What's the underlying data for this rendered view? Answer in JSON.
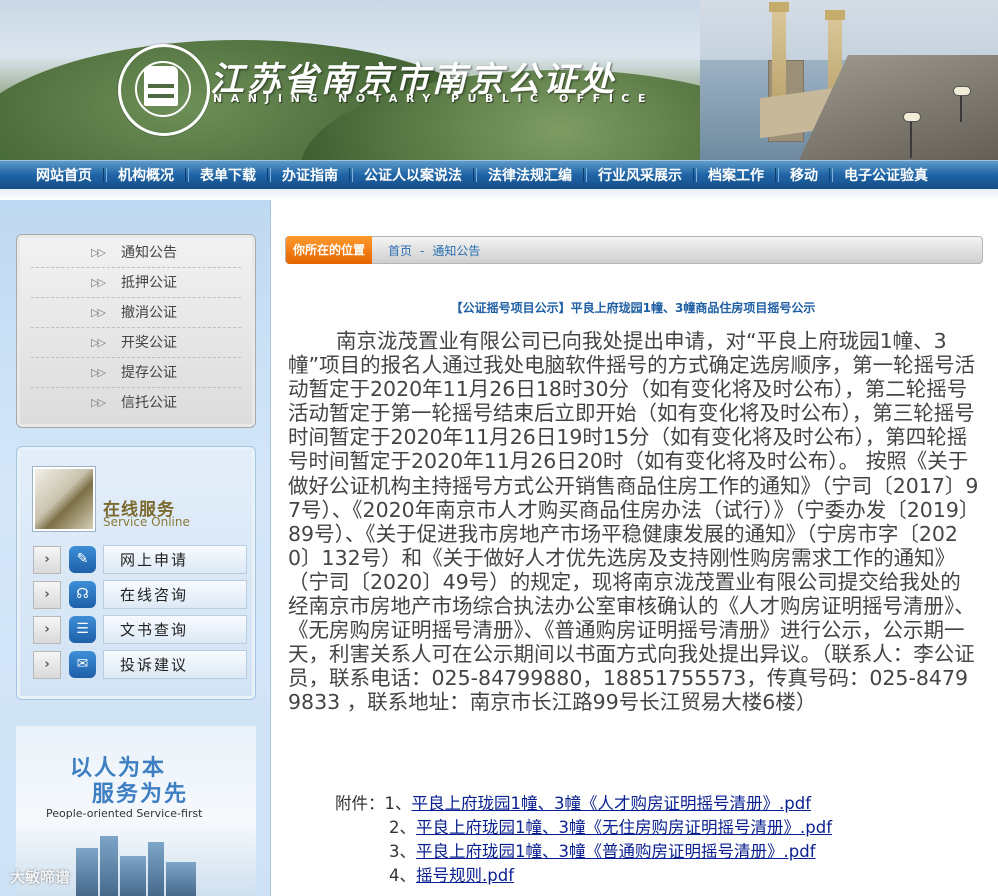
{
  "header": {
    "title_cn": "江苏省南京市南京公证处",
    "title_en": "NANJING NOTARY PUBLIC OFFICE",
    "seal_text": "南京公证处 NANJING NOTARY PUBLIC OFFICE"
  },
  "nav": {
    "items": [
      "网站首页",
      "机构概况",
      "表单下载",
      "办证指南",
      "公证人以案说法",
      "法律法规汇编",
      "行业风采展示",
      "档案工作",
      "移动",
      "电子公证验真"
    ]
  },
  "sidebar": {
    "notices": [
      "通知公告",
      "抵押公证",
      "撤消公证",
      "开奖公证",
      "提存公证",
      "信托公证"
    ],
    "online": {
      "title": "在线服务",
      "subtitle": "Service Online",
      "items": [
        {
          "label": "网上申请",
          "icon": "edit-icon"
        },
        {
          "label": "在线咨询",
          "icon": "headset-icon"
        },
        {
          "label": "文书查询",
          "icon": "document-list-icon"
        },
        {
          "label": "投诉建议",
          "icon": "chat-bubble-icon"
        }
      ],
      "arrow": "›"
    },
    "promo": {
      "line1": "以人为本",
      "line2": "服务为先",
      "en": "People-oriented  Service-first"
    },
    "watermark": "大敏啼谱"
  },
  "breadcrumb": {
    "label": "你所在的位置",
    "home": "首页",
    "separator": "-",
    "current": "通知公告"
  },
  "article": {
    "title": "【公证摇号项目公示】平良上府珑园1幢、3幢商品住房项目摇号公示",
    "body": "南京泷茂置业有限公司已向我处提出申请，对“平良上府珑园1幢、3幢”项目的报名人通过我处电脑软件摇号的方式确定选房顺序，第一轮摇号活动暂定于2020年11月26日18时30分（如有变化将及时公布），第二轮摇号活动暂定于第一轮摇号结束后立即开始（如有变化将及时公布），第三轮摇号时间暂定于2020年11月26日19时15分（如有变化将及时公布），第四轮摇号时间暂定于2020年11月26日20时（如有变化将及时公布）。 按照《关于做好公证机构主持摇号方式公开销售商品住房工作的通知》（宁司〔2017〕97号）、《2020年南京市人才购买商品住房办法（试行）》（宁委办发〔2019〕89号）、《关于促进我市房地产市场平稳健康发展的通知》（宁房市字〔2020〕132号）和《关于做好人才优先选房及支持刚性购房需求工作的通知》（宁司〔2020〕49号）的规定，现将南京泷茂置业有限公司提交给我处的经南京市房地产市场综合执法办公室审核确认的《人才购房证明摇号清册》、《无房购房证明摇号清册》、《普通购房证明摇号清册》进行公示，公示期一天，利害关系人可在公示期间以书面方式向我处提出异议。（联系人：李公证员，联系电话：025-84799880，18851755573，传真号码：025-84799833 ，联系地址：南京市长江路99号长江贸易大楼6楼）",
    "attachments_label": "附件：",
    "attachments": [
      {
        "num": "1、",
        "name": "平良上府珑园1幢、3幢《人才购房证明摇号清册》.pdf"
      },
      {
        "num": "2、",
        "name": "平良上府珑园1幢、3幢《无住房购房证明摇号清册》.pdf"
      },
      {
        "num": "3、",
        "name": "平良上府珑园1幢、3幢《普通购房证明摇号清册》.pdf"
      },
      {
        "num": "4、",
        "name": "摇号规则.pdf"
      }
    ]
  },
  "colors": {
    "nav_bg": "#1f64a6",
    "breadcrumb_label": "#e56400",
    "link": "#0a1f8f",
    "title": "#1f5fa3"
  }
}
